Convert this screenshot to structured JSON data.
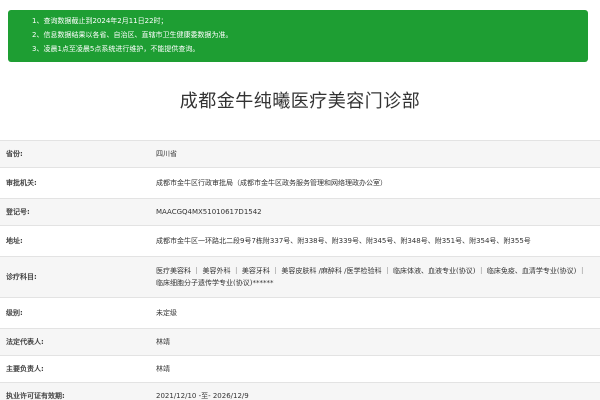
{
  "notice": {
    "items": [
      "1、查询数据截止到2024年2月11日22时；",
      "2、信息数据结果以各省、自治区、直辖市卫生健康委数据为准。",
      "3、凌晨1点至凌晨5点系统进行维护，不能提供查询。"
    ],
    "background": "#1e9e33"
  },
  "title": "成都金牛纯曦医疗美容门诊部",
  "info": {
    "province_label": "省份:",
    "province_value": "四川省",
    "authority_label": "审批机关:",
    "authority_value": "成都市金牛区行政审批局（成都市金牛区政务服务管理和网络理政办公室）",
    "reg_label": "登记号:",
    "reg_value": "MAACGQ4MX51010617D1542",
    "address_label": "地址:",
    "address_value": "成都市金牛区一环路北二段9号7栋附337号、附338号、附339号、附345号、附348号、附351号、附354号、附355号",
    "subjects_label": "诊疗科目:",
    "subjects_value": "医疗美容科 ｜ 美容外科 ｜ 美容牙科 ｜ 美容皮肤科 /麻醉科 /医学检验科 ｜ 临床体液、血液专业(协议) ｜ 临床免疫、血清学专业(协议) ｜ 临床细胞分子遗传学专业(协议)******",
    "grade_label": "级别:",
    "grade_value": "未定级",
    "legal_label": "法定代表人:",
    "legal_value": "林靖",
    "principal_label": "主要负责人:",
    "principal_value": "林靖",
    "validity_label": "执业许可证有效期:",
    "validity_value": "2021/12/10 -至- 2026/12/9"
  }
}
